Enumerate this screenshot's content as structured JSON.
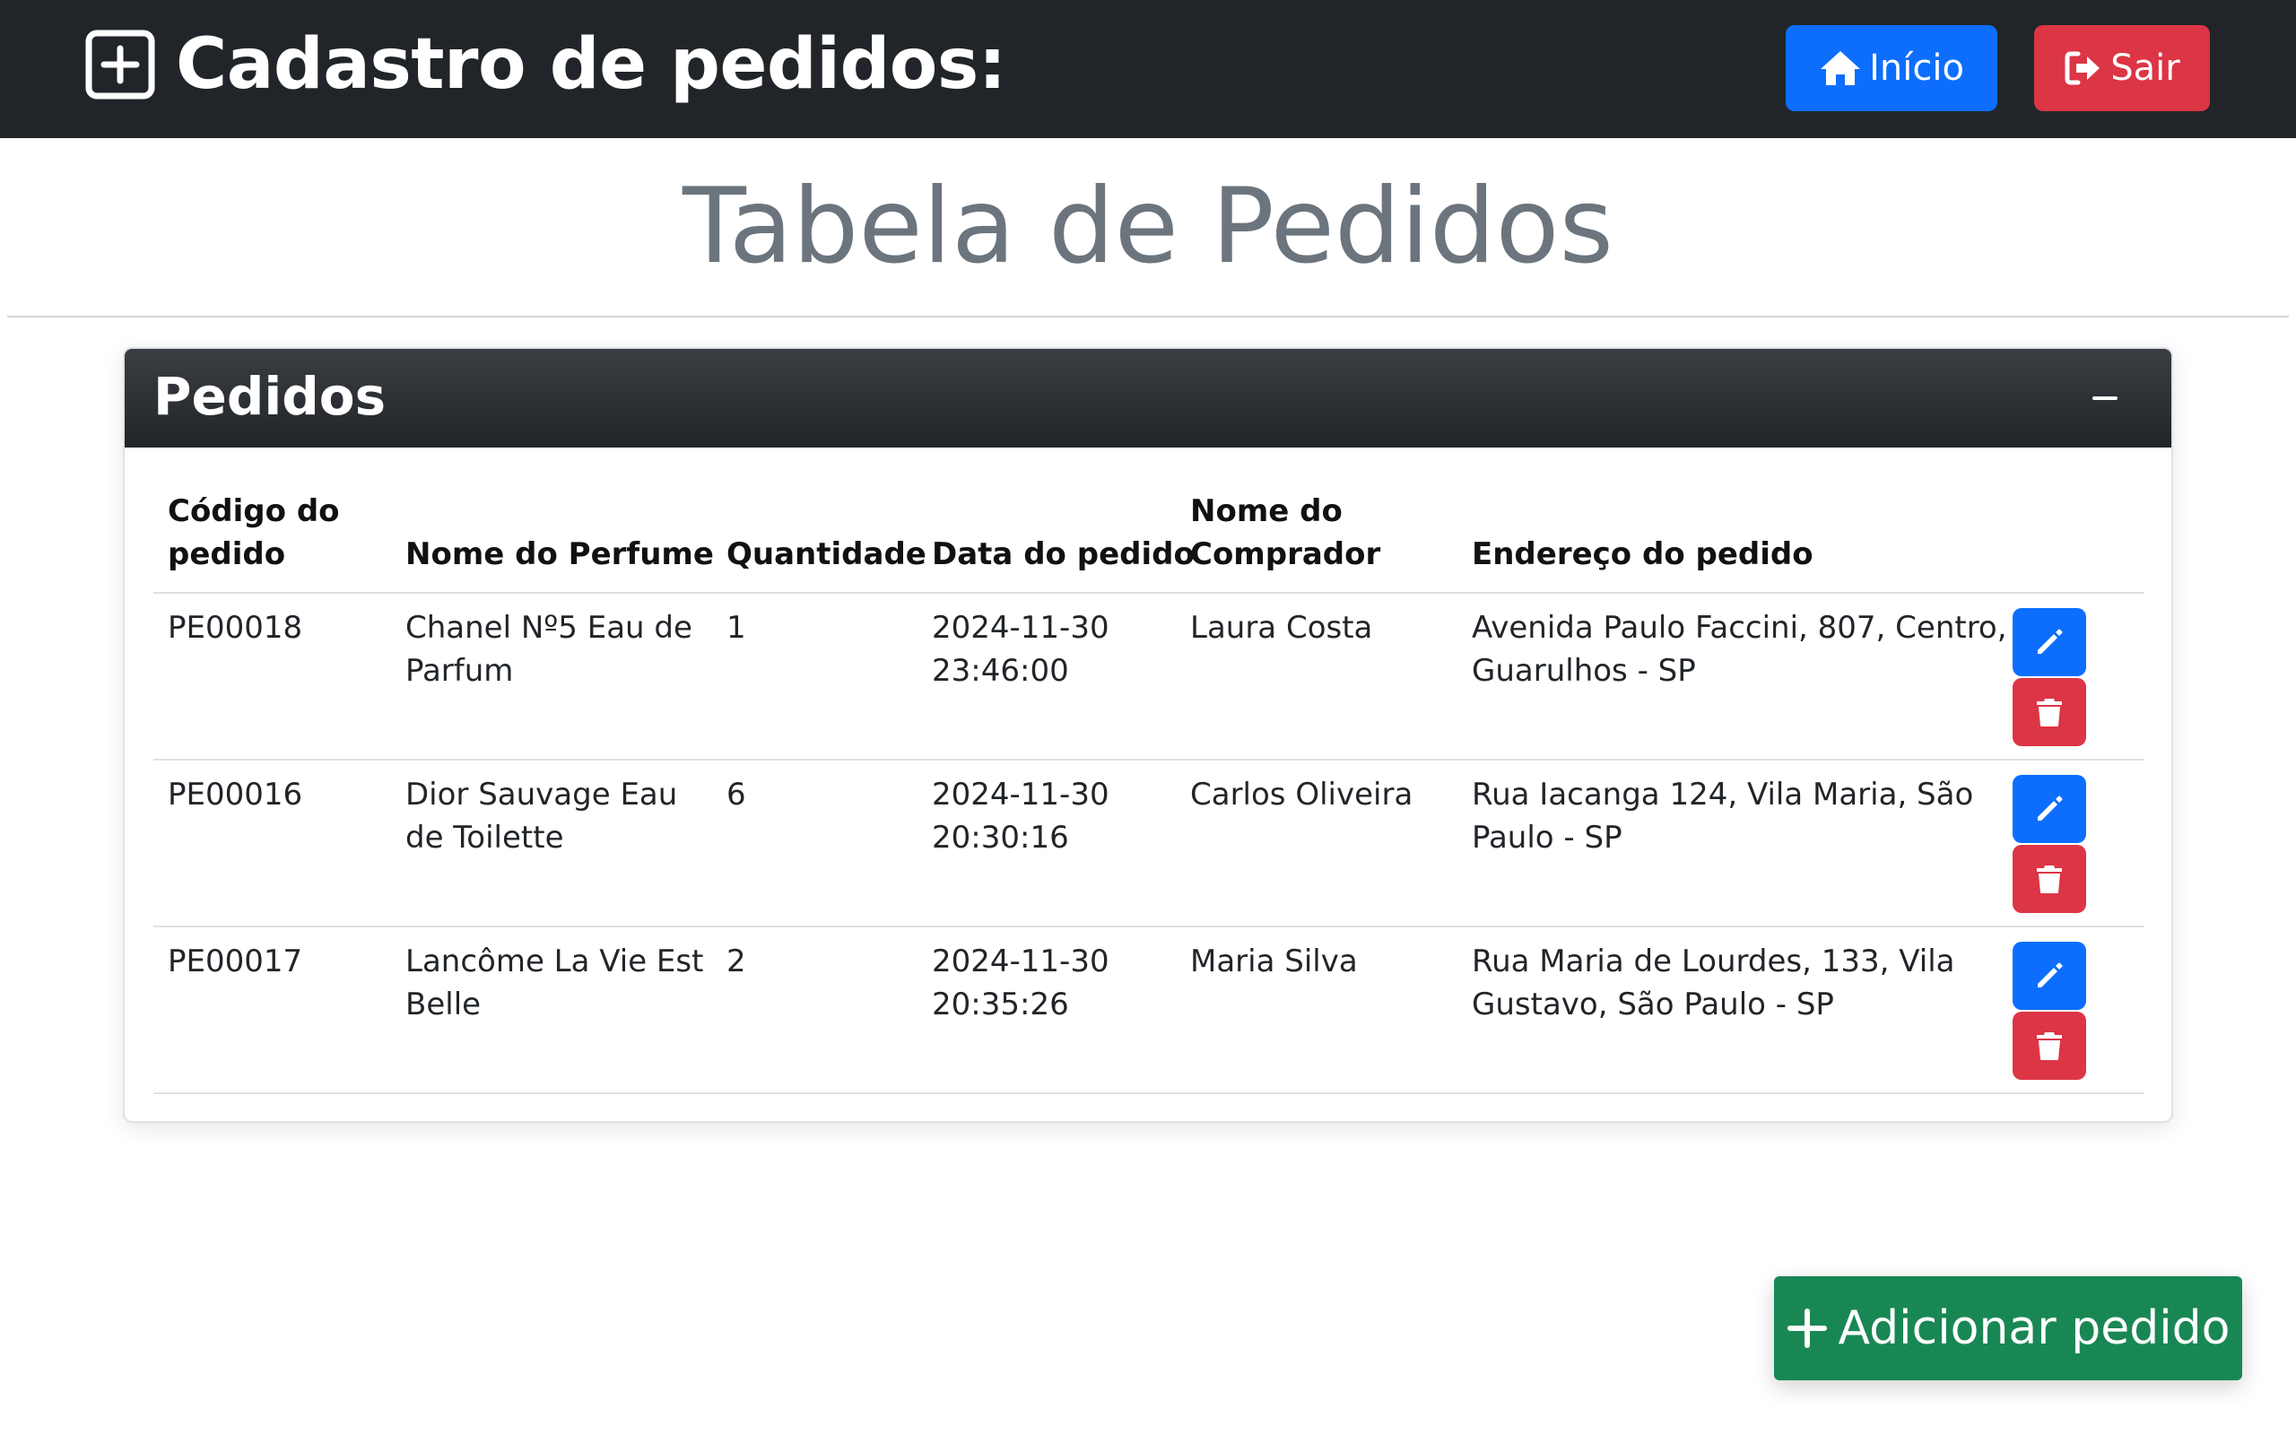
{
  "navbar": {
    "title": "Cadastro de pedidos:",
    "brand_icon": "plus-square-icon",
    "home_label": "Início",
    "home_icon": "house-icon",
    "exit_label": "Sair",
    "exit_icon": "logout-icon"
  },
  "page": {
    "heading": "Tabela de Pedidos"
  },
  "card": {
    "title": "Pedidos",
    "collapse_icon": "minus-icon"
  },
  "table": {
    "headers": {
      "code": [
        "Código do",
        "pedido"
      ],
      "perfume": "Nome do Perfume",
      "quantity": "Quantidade",
      "date": "Data do pedido",
      "buyer": [
        "Nome do",
        "Comprador"
      ],
      "address": "Endereço do pedido"
    },
    "rows": [
      {
        "code": "PE00018",
        "perfume": [
          "Chanel Nº5 Eau de",
          "Parfum"
        ],
        "quantity": "1",
        "date": [
          "2024-11-30",
          "23:46:00"
        ],
        "buyer": "Laura Costa",
        "address": [
          "Avenida Paulo Faccini, 807, Centro,",
          "Guarulhos - SP"
        ]
      },
      {
        "code": "PE00016",
        "perfume": [
          "Dior Sauvage Eau",
          "de Toilette"
        ],
        "quantity": "6",
        "date": [
          "2024-11-30",
          "20:30:16"
        ],
        "buyer": "Carlos Oliveira",
        "address": [
          "Rua Iacanga 124, Vila Maria, São",
          "Paulo - SP"
        ]
      },
      {
        "code": "PE00017",
        "perfume": [
          "Lancôme La Vie Est",
          "Belle"
        ],
        "quantity": "2",
        "date": [
          "2024-11-30",
          "20:35:26"
        ],
        "buyer": "Maria Silva",
        "address": [
          "Rua Maria de Lourdes, 133, Vila",
          "Gustavo, São Paulo - SP"
        ]
      }
    ],
    "edit_icon": "pencil-icon",
    "delete_icon": "trash-icon"
  },
  "add_button": {
    "label": "Adicionar pedido",
    "icon": "plus-icon"
  },
  "colors": {
    "navbar": "#212529",
    "primary": "#0d6efd",
    "danger": "#dc3545",
    "success": "#198754",
    "heading": "#6c757d"
  }
}
